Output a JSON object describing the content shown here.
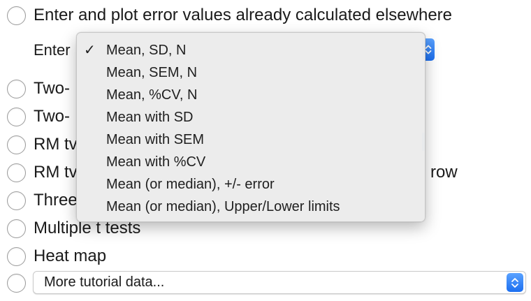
{
  "options": [
    {
      "label": "Enter and plot error values already calculated elsewhere"
    },
    {
      "label": "Two-"
    },
    {
      "label": "Two-"
    },
    {
      "label": "RM tv"
    },
    {
      "label": "RM tv"
    },
    {
      "label": "Three"
    },
    {
      "label": "Multiple t tests"
    },
    {
      "label": "Heat map"
    }
  ],
  "enter_label": "Enter",
  "row_suffix": "row",
  "menu": {
    "selected_index": 0,
    "check_glyph": "✓",
    "items": [
      "Mean, SD, N",
      "Mean, SEM, N",
      "Mean, %CV, N",
      "Mean with SD",
      "Mean with SEM",
      "Mean with %CV",
      "Mean (or median), +/- error",
      "Mean (or median), Upper/Lower limits"
    ]
  },
  "tutorial_select": {
    "value": "More tutorial data..."
  },
  "colors": {
    "accent": "#1c6ff0",
    "menu_bg": "#ececec"
  },
  "icons": {
    "stepper": "up-down-chevron-icon",
    "radio": "radio-button-icon",
    "check": "checkmark-icon"
  }
}
